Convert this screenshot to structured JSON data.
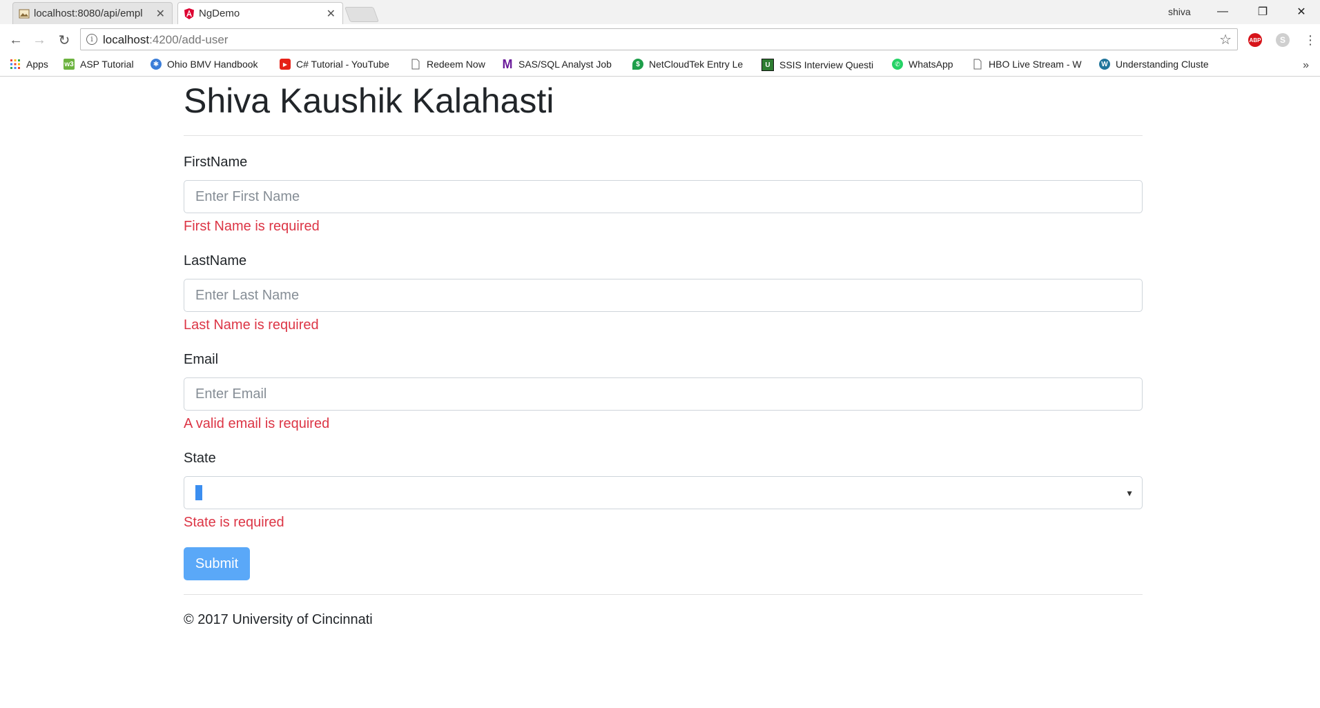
{
  "browser": {
    "tabs": [
      {
        "title": "localhost:8080/api/empl",
        "active": false
      },
      {
        "title": "NgDemo",
        "active": true
      }
    ],
    "profile_name": "shiva",
    "window_controls": {
      "minimize": "—",
      "restore": "❐",
      "close": "✕"
    },
    "url_host": "localhost",
    "url_path": ":4200/add-user",
    "bookmarks": [
      {
        "label": "Apps",
        "icon": "apps-grid-icon",
        "color": "#e94235"
      },
      {
        "label": "ASP Tutorial",
        "icon": "asp-tutorial-icon",
        "color": "#6cb33f"
      },
      {
        "label": "Ohio BMV Handbook",
        "icon": "ohio-bmv-icon",
        "color": "#3b7dd8"
      },
      {
        "label": "C# Tutorial - YouTube",
        "icon": "youtube-icon",
        "color": "#e62117"
      },
      {
        "label": "Redeem Now",
        "icon": "page-icon",
        "color": "#ffffff"
      },
      {
        "label": "SAS/SQL Analyst Job",
        "icon": "m-logo-icon",
        "color": "#6a1b9a"
      },
      {
        "label": "NetCloudTek Entry Le",
        "icon": "netcloudtek-icon",
        "color": "#1e9e4a"
      },
      {
        "label": "SSIS Interview Questi",
        "icon": "u-logo-icon",
        "color": "#2e7d32"
      },
      {
        "label": "WhatsApp",
        "icon": "whatsapp-icon",
        "color": "#25d366"
      },
      {
        "label": "HBO Live Stream - W",
        "icon": "page-icon",
        "color": "#ffffff"
      },
      {
        "label": "Understanding Cluste",
        "icon": "wordpress-icon",
        "color": "#21759b"
      }
    ],
    "bookmarks_more": "»"
  },
  "page": {
    "title": "Shiva Kaushik Kalahasti",
    "form": {
      "first_name": {
        "label": "FirstName",
        "placeholder": "Enter First Name",
        "error": "First Name is required"
      },
      "last_name": {
        "label": "LastName",
        "placeholder": "Enter Last Name",
        "error": "Last Name is required"
      },
      "email": {
        "label": "Email",
        "placeholder": "Enter Email",
        "error": "A valid email is required"
      },
      "state": {
        "label": "State",
        "value": "",
        "error": "State is required"
      },
      "submit_label": "Submit"
    },
    "footer": "© 2017 University of Cincinnati"
  },
  "colors": {
    "error": "#dc3545",
    "primary_button": "#5aa8f8",
    "text": "#212529"
  }
}
